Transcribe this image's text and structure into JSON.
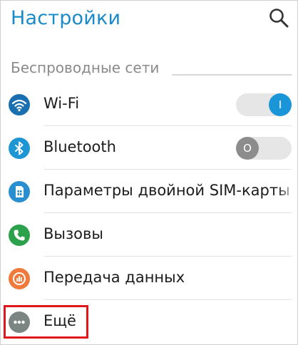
{
  "header": {
    "title": "Настройки",
    "search_icon": "search-icon"
  },
  "section": {
    "title": "Беспроводные сети"
  },
  "items": [
    {
      "label": "Wi-Fi",
      "icon": "wifi-icon",
      "icon_color": "#1a6fb0",
      "toggle": {
        "state": "on",
        "knob_text": "I"
      }
    },
    {
      "label": "Bluetooth",
      "icon": "bluetooth-icon",
      "icon_color": "#1e96d4",
      "toggle": {
        "state": "off",
        "knob_text": "O"
      }
    },
    {
      "label": "Параметры двойной SIM-карты",
      "icon": "sim-card-icon",
      "icon_color": "#2a8fd0"
    },
    {
      "label": "Вызовы",
      "icon": "phone-icon",
      "icon_color": "#2aa14a"
    },
    {
      "label": "Передача данных",
      "icon": "data-usage-icon",
      "icon_color": "#f07a3c"
    },
    {
      "label": "Ещё",
      "icon": "more-icon",
      "icon_color": "#7b8683"
    }
  ],
  "colors": {
    "accent": "#1a8ac8",
    "highlight": "#e0161b"
  }
}
